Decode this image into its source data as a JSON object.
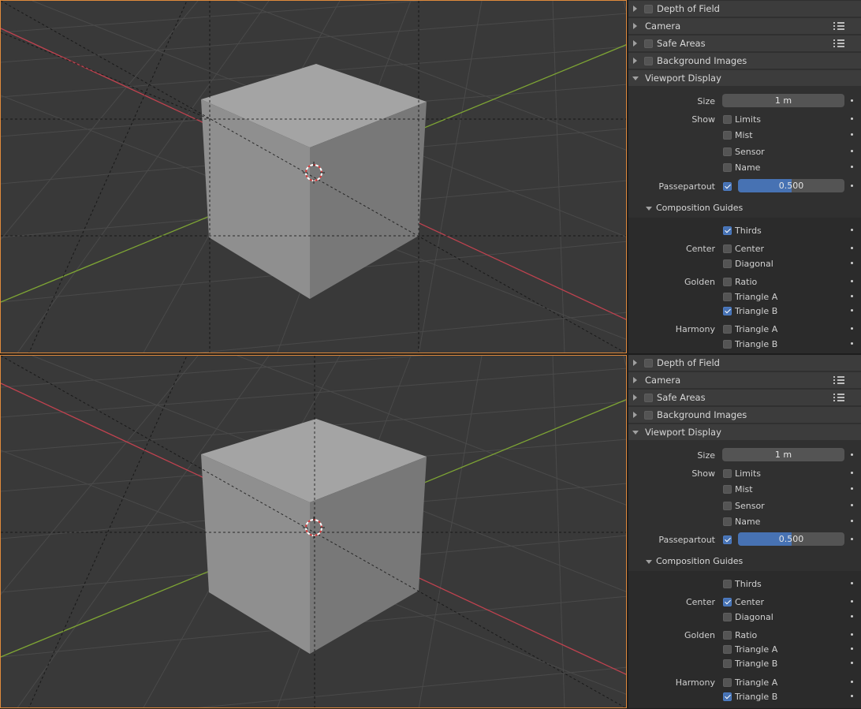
{
  "panels": [
    {
      "sections": {
        "depth_of_field": "Depth of Field",
        "camera": "Camera",
        "safe_areas": "Safe Areas",
        "background_images": "Background Images",
        "viewport_display": "Viewport Display"
      },
      "size": {
        "label": "Size",
        "value": "1 m"
      },
      "show": {
        "label": "Show",
        "limits": "Limits",
        "mist": "Mist",
        "sensor": "Sensor",
        "name": "Name"
      },
      "passepartout": {
        "label": "Passepartout",
        "checked": true,
        "value": "0.500",
        "fraction": 0.5
      },
      "composition_guides": {
        "title": "Composition Guides",
        "thirds": {
          "label": "Thirds",
          "checked": true
        },
        "center_group": "Center",
        "center": {
          "label": "Center",
          "checked": false
        },
        "diagonal": {
          "label": "Diagonal",
          "checked": false
        },
        "golden_group": "Golden",
        "golden_ratio": {
          "label": "Ratio",
          "checked": false
        },
        "golden_triangle_a": {
          "label": "Triangle A",
          "checked": false
        },
        "golden_triangle_b": {
          "label": "Triangle B",
          "checked": true
        },
        "harmony_group": "Harmony",
        "harmony_triangle_a": {
          "label": "Triangle A",
          "checked": false
        },
        "harmony_triangle_b": {
          "label": "Triangle B",
          "checked": false
        }
      }
    },
    {
      "sections": {
        "depth_of_field": "Depth of Field",
        "camera": "Camera",
        "safe_areas": "Safe Areas",
        "background_images": "Background Images",
        "viewport_display": "Viewport Display"
      },
      "size": {
        "label": "Size",
        "value": "1 m"
      },
      "show": {
        "label": "Show",
        "limits": "Limits",
        "mist": "Mist",
        "sensor": "Sensor",
        "name": "Name"
      },
      "passepartout": {
        "label": "Passepartout",
        "checked": true,
        "value": "0.500",
        "fraction": 0.5
      },
      "composition_guides": {
        "title": "Composition Guides",
        "thirds": {
          "label": "Thirds",
          "checked": false
        },
        "center_group": "Center",
        "center": {
          "label": "Center",
          "checked": true
        },
        "diagonal": {
          "label": "Diagonal",
          "checked": false
        },
        "golden_group": "Golden",
        "golden_ratio": {
          "label": "Ratio",
          "checked": false
        },
        "golden_triangle_a": {
          "label": "Triangle A",
          "checked": false
        },
        "golden_triangle_b": {
          "label": "Triangle B",
          "checked": false
        },
        "harmony_group": "Harmony",
        "harmony_triangle_a": {
          "label": "Triangle A",
          "checked": false
        },
        "harmony_triangle_b": {
          "label": "Triangle B",
          "checked": true
        }
      }
    }
  ],
  "colors": {
    "viewport_border": "#e08a3c",
    "x_axis": "#c0424f",
    "y_axis": "#7ea534",
    "checkbox_on": "#4772b3"
  },
  "viewports": [
    {
      "guide": "thirds"
    },
    {
      "guide": "center"
    }
  ]
}
